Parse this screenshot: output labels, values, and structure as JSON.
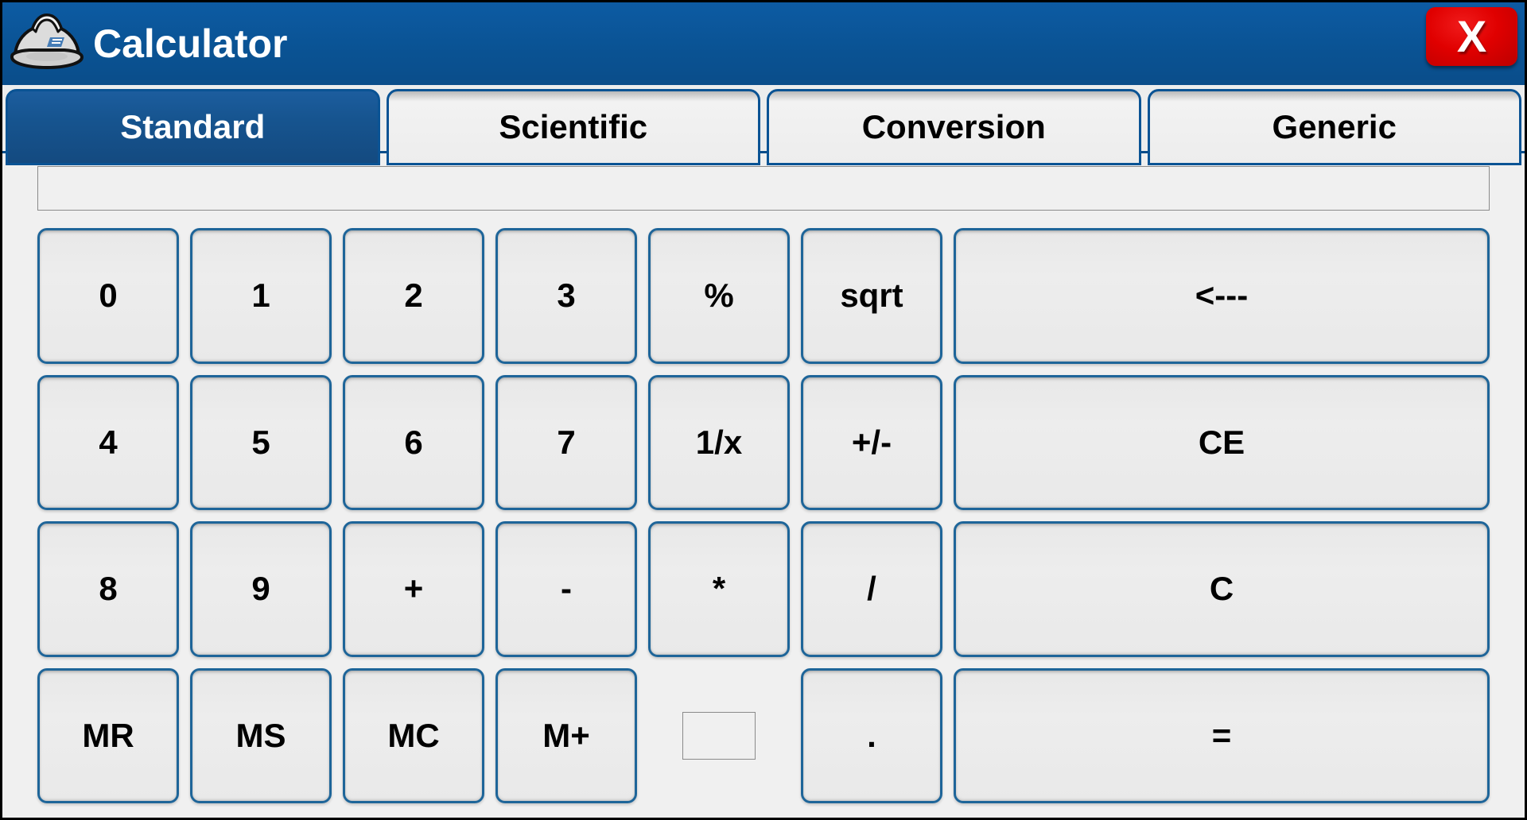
{
  "window": {
    "title": "Calculator",
    "icon": "hard-hat-icon",
    "close_label": "X",
    "titlebar_color": "#0a5394",
    "close_color": "#e00000",
    "accent_color": "#1e6599",
    "body_color": "#f0f0f0"
  },
  "tabs": [
    {
      "label": "Standard",
      "active": true
    },
    {
      "label": "Scientific",
      "active": false
    },
    {
      "label": "Conversion",
      "active": false
    },
    {
      "label": "Generic",
      "active": false
    }
  ],
  "display": {
    "value": "",
    "placeholder": ""
  },
  "mini_field": {
    "value": "",
    "placeholder": ""
  },
  "keypad": {
    "rows": [
      {
        "keys": [
          "0",
          "1",
          "2",
          "3",
          "%",
          "sqrt"
        ],
        "wide": "<---"
      },
      {
        "keys": [
          "4",
          "5",
          "6",
          "7",
          "1/x",
          "+/-"
        ],
        "wide": "CE"
      },
      {
        "keys": [
          "8",
          "9",
          "+",
          "-",
          "*",
          "/"
        ],
        "wide": "C"
      },
      {
        "keys": [
          "MR",
          "MS",
          "MC",
          "M+",
          "",
          "."
        ],
        "wide": "="
      }
    ]
  }
}
